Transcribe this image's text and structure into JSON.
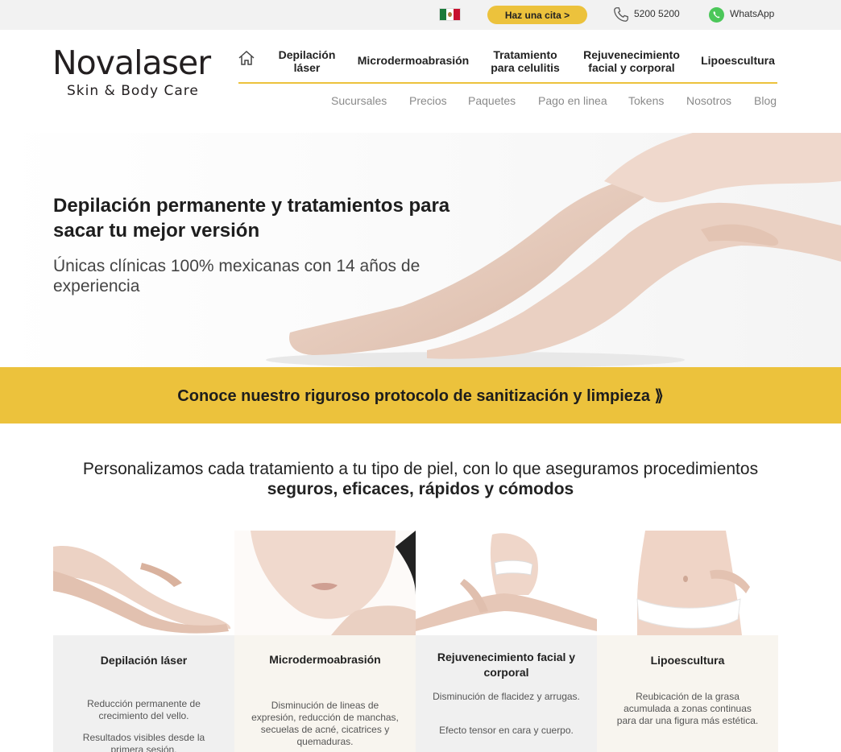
{
  "topbar": {
    "cta_label": "Haz una cita >",
    "phone": "5200 5200",
    "whatsapp": "WhatsApp",
    "flag_icon": "mexico-flag-icon"
  },
  "brand": {
    "name": "Novalaser",
    "tagline": "Skin & Body Care"
  },
  "mainnav": [
    {
      "label": "Depilación láser"
    },
    {
      "label": "Microdermoabrasión"
    },
    {
      "label": "Tratamiento para celulitis"
    },
    {
      "label": "Rejuvenecimiento facial y corporal"
    },
    {
      "label": "Lipoescultura"
    }
  ],
  "subnav": [
    "Sucursales",
    "Precios",
    "Paquetes",
    "Pago en linea",
    "Tokens",
    "Nosotros",
    "Blog"
  ],
  "hero": {
    "title": "Depilación permanente y tratamientos para sacar tu mejor versión",
    "subtitle": "Únicas clínicas 100% mexicanas con 14 años de experiencia"
  },
  "banner": {
    "label": "Conoce nuestro riguroso protocolo de sanitización y limpieza ⟫"
  },
  "intro": {
    "text": "Personalizamos cada tratamiento a tu tipo de piel, con lo que aseguramos procedimientos ",
    "bold": "seguros, eficaces, rápidos y cómodos"
  },
  "cards": [
    {
      "title": "Depilación láser",
      "p1": "Reducción permanente de crecimiento del vello.",
      "p2": "Resultados visibles desde la primera sesión."
    },
    {
      "title": "Microdermoabrasión",
      "p1": "Disminución de lineas de expresión, reducción de manchas, secuelas de acné, cicatrices y quemaduras.",
      "p2": ""
    },
    {
      "title": "Rejuvenecimiento facial y corporal",
      "p1": "Disminución de flacidez y arrugas.",
      "p2": "Efecto tensor en cara y cuerpo."
    },
    {
      "title": "Lipoescultura",
      "p1": "Reubicación de la grasa acumulada a zonas continuas para dar una figura más estética.",
      "p2": ""
    }
  ],
  "colors": {
    "accent": "#ecc23c",
    "whatsapp": "#4bc759"
  }
}
